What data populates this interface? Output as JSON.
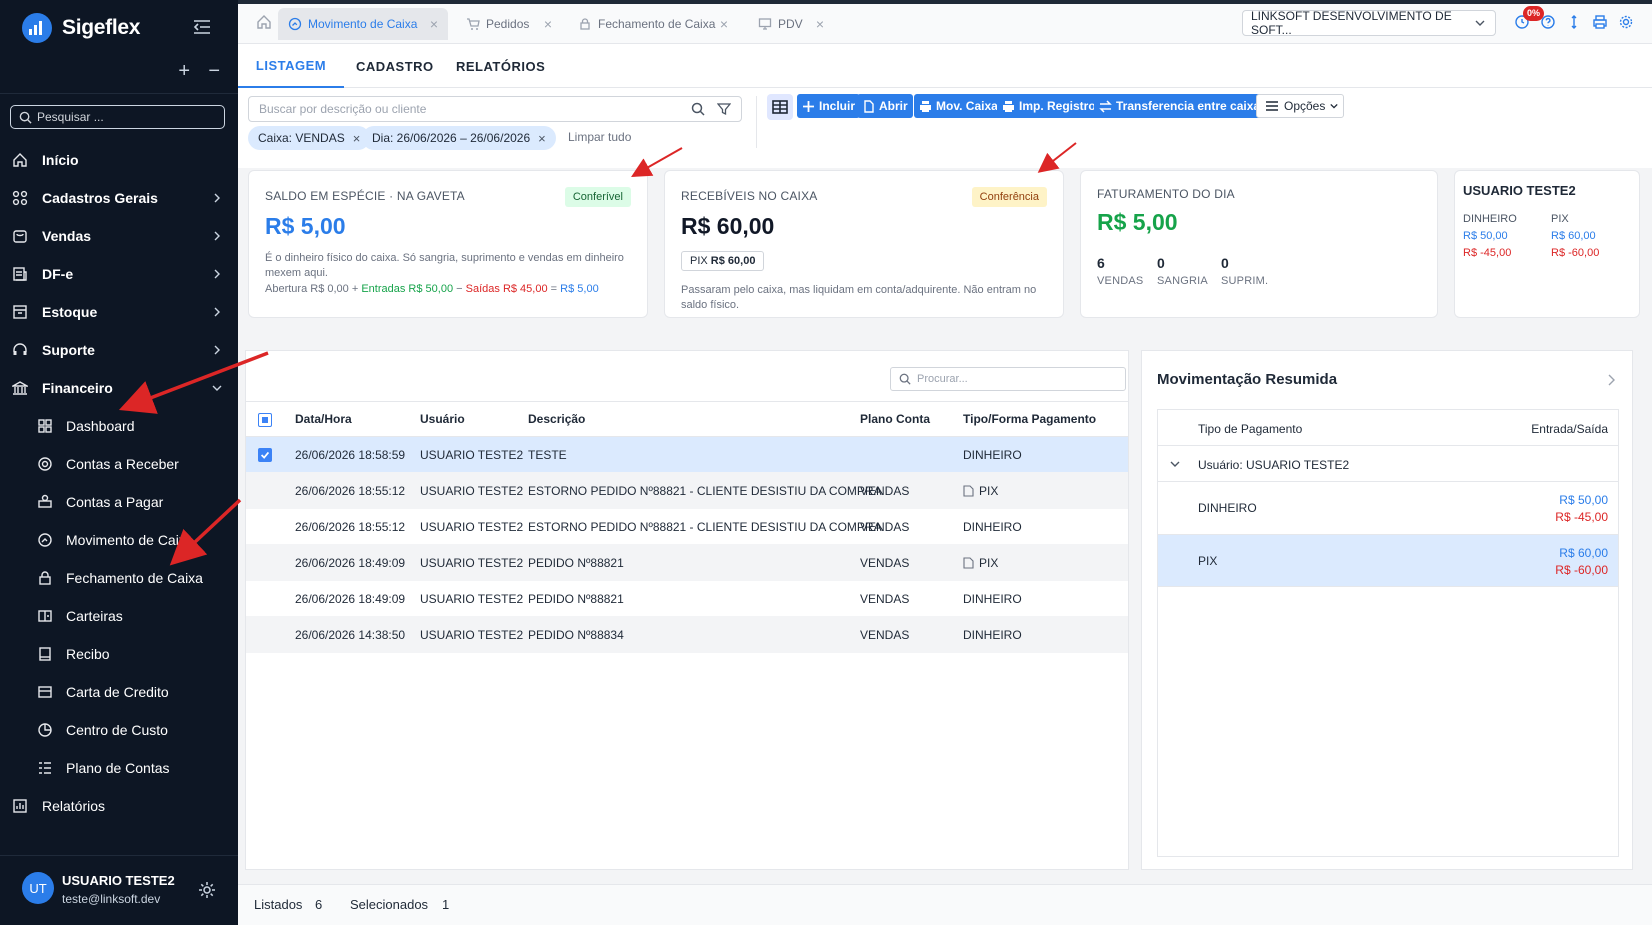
{
  "app": {
    "name": "Sigeflex"
  },
  "sidebar": {
    "search_placeholder": "Pesquisar ...",
    "items": [
      {
        "label": "Início",
        "icon": "home-icon"
      },
      {
        "label": "Cadastros Gerais",
        "icon": "grid-icon"
      },
      {
        "label": "Vendas",
        "icon": "cart-icon"
      },
      {
        "label": "DF-e",
        "icon": "document-icon"
      },
      {
        "label": "Estoque",
        "icon": "box-icon"
      },
      {
        "label": "Suporte",
        "icon": "headset-icon"
      },
      {
        "label": "Financeiro",
        "icon": "bank-icon"
      }
    ],
    "sub_items": [
      {
        "label": "Dashboard",
        "icon": "dashboard-icon"
      },
      {
        "label": "Contas a Receber",
        "icon": "coin-icon"
      },
      {
        "label": "Contas a Pagar",
        "icon": "money-stack-icon"
      },
      {
        "label": "Movimento de Caixa",
        "icon": "gauge-icon"
      },
      {
        "label": "Fechamento de Caixa",
        "icon": "lock-icon"
      },
      {
        "label": "Carteiras",
        "icon": "wallet-icon"
      },
      {
        "label": "Recibo",
        "icon": "receipt-icon"
      },
      {
        "label": "Carta de Credito",
        "icon": "card-icon"
      },
      {
        "label": "Centro de Custo",
        "icon": "pie-icon"
      },
      {
        "label": "Plano de Contas",
        "icon": "list-icon"
      }
    ],
    "reports_label": "Relatórios",
    "user": {
      "initials": "UT",
      "name": "USUARIO TESTE2",
      "email": "teste@linksoft.dev"
    }
  },
  "tabs": [
    {
      "label": "Movimento de Caixa",
      "active": true
    },
    {
      "label": "Pedidos"
    },
    {
      "label": "Fechamento de Caixa"
    },
    {
      "label": "PDV"
    }
  ],
  "header": {
    "company": "LINKSOFT DESENVOLVIMENTO DE SOFT...",
    "badge": "0%"
  },
  "section_tabs": [
    "LISTAGEM",
    "CADASTRO",
    "RELATÓRIOS"
  ],
  "toolbar": {
    "search_placeholder": "Buscar por descrição ou cliente",
    "buttons": [
      "Incluir",
      "Abrir",
      "Mov. Caixa",
      "Imp. Registro",
      "Transferencia entre caixas"
    ],
    "options_label": "Opções",
    "filters": [
      "Caixa: VENDAS",
      "Dia: 26/06/2026 – 26/06/2026"
    ],
    "clear_label": "Limpar tudo"
  },
  "cards": {
    "especie": {
      "title": "SALDO EM ESPÉCIE · NA GAVETA",
      "badge": "Conferível",
      "value": "R$ 5,00",
      "desc": "É o dinheiro físico do caixa. Só sangria, suprimento e vendas em dinheiro mexem aqui.",
      "f_abertura": "Abertura R$ 0,00",
      "f_plus": "+",
      "f_entradas": "Entradas R$ 50,00",
      "f_minus": "−",
      "f_saidas": "Saídas R$ 45,00",
      "f_eq": "=",
      "f_total": "R$ 5,00"
    },
    "recebiveis": {
      "title": "RECEBÍVEIS NO CAIXA",
      "badge": "Conferência",
      "value": "R$ 60,00",
      "pill_label": "PIX",
      "pill_value": "R$ 60,00",
      "desc": "Passaram pelo caixa, mas liquidam em conta/adquirente. Não entram no saldo físico."
    },
    "faturamento": {
      "title": "FATURAMENTO DO DIA",
      "value": "R$ 5,00",
      "stats": [
        {
          "n": "6",
          "l": "VENDAS"
        },
        {
          "n": "0",
          "l": "SANGRIA"
        },
        {
          "n": "0",
          "l": "SUPRIM."
        }
      ]
    },
    "usuario": {
      "title": "USUARIO TESTE2",
      "cols": [
        {
          "label": "DINHEIRO",
          "in": "R$ 50,00",
          "out": "R$ -45,00"
        },
        {
          "label": "PIX",
          "in": "R$ 60,00",
          "out": "R$ -60,00"
        }
      ]
    }
  },
  "grid": {
    "search_placeholder": "Procurar...",
    "columns": [
      "Data/Hora",
      "Usuário",
      "Descrição",
      "Plano Conta",
      "Tipo/Forma Pagamento"
    ],
    "rows": [
      {
        "datetime": "26/06/2026 18:58:59",
        "user": "USUARIO TESTE2",
        "desc": "TESTE",
        "plano": "",
        "tipo": "DINHEIRO"
      },
      {
        "datetime": "26/06/2026 18:55:12",
        "user": "USUARIO TESTE2",
        "desc": "ESTORNO PEDIDO Nº88821 - CLIENTE DESISTIU DA COMPRA",
        "plano": "VENDAS",
        "tipo": "PIX"
      },
      {
        "datetime": "26/06/2026 18:55:12",
        "user": "USUARIO TESTE2",
        "desc": "ESTORNO PEDIDO Nº88821 - CLIENTE DESISTIU DA COMPRA",
        "plano": "VENDAS",
        "tipo": "DINHEIRO"
      },
      {
        "datetime": "26/06/2026 18:49:09",
        "user": "USUARIO TESTE2",
        "desc": "PEDIDO Nº88821",
        "plano": "VENDAS",
        "tipo": "PIX"
      },
      {
        "datetime": "26/06/2026 18:49:09",
        "user": "USUARIO TESTE2",
        "desc": "PEDIDO Nº88821",
        "plano": "VENDAS",
        "tipo": "DINHEIRO"
      },
      {
        "datetime": "26/06/2026 14:38:50",
        "user": "USUARIO TESTE2",
        "desc": "PEDIDO Nº88834",
        "plano": "VENDAS",
        "tipo": "DINHEIRO"
      }
    ]
  },
  "resumo": {
    "title": "Movimentação Resumida",
    "col_tipo": "Tipo de Pagamento",
    "col_es": "Entrada/Saída",
    "group": "Usuário: USUARIO TESTE2",
    "rows": [
      {
        "label": "DINHEIRO",
        "in": "R$ 50,00",
        "out": "R$ -45,00"
      },
      {
        "label": "PIX",
        "in": "R$ 60,00",
        "out": "R$ -60,00"
      }
    ]
  },
  "status": {
    "listados_label": "Listados",
    "listados": "6",
    "selecionados_label": "Selecionados",
    "selecionados": "1"
  },
  "colors": {
    "accent": "#2b7de9",
    "sidebar": "#0d1624",
    "negative": "#dc2626",
    "positive_green": "#16a34a",
    "arrow": "#dc2626"
  }
}
